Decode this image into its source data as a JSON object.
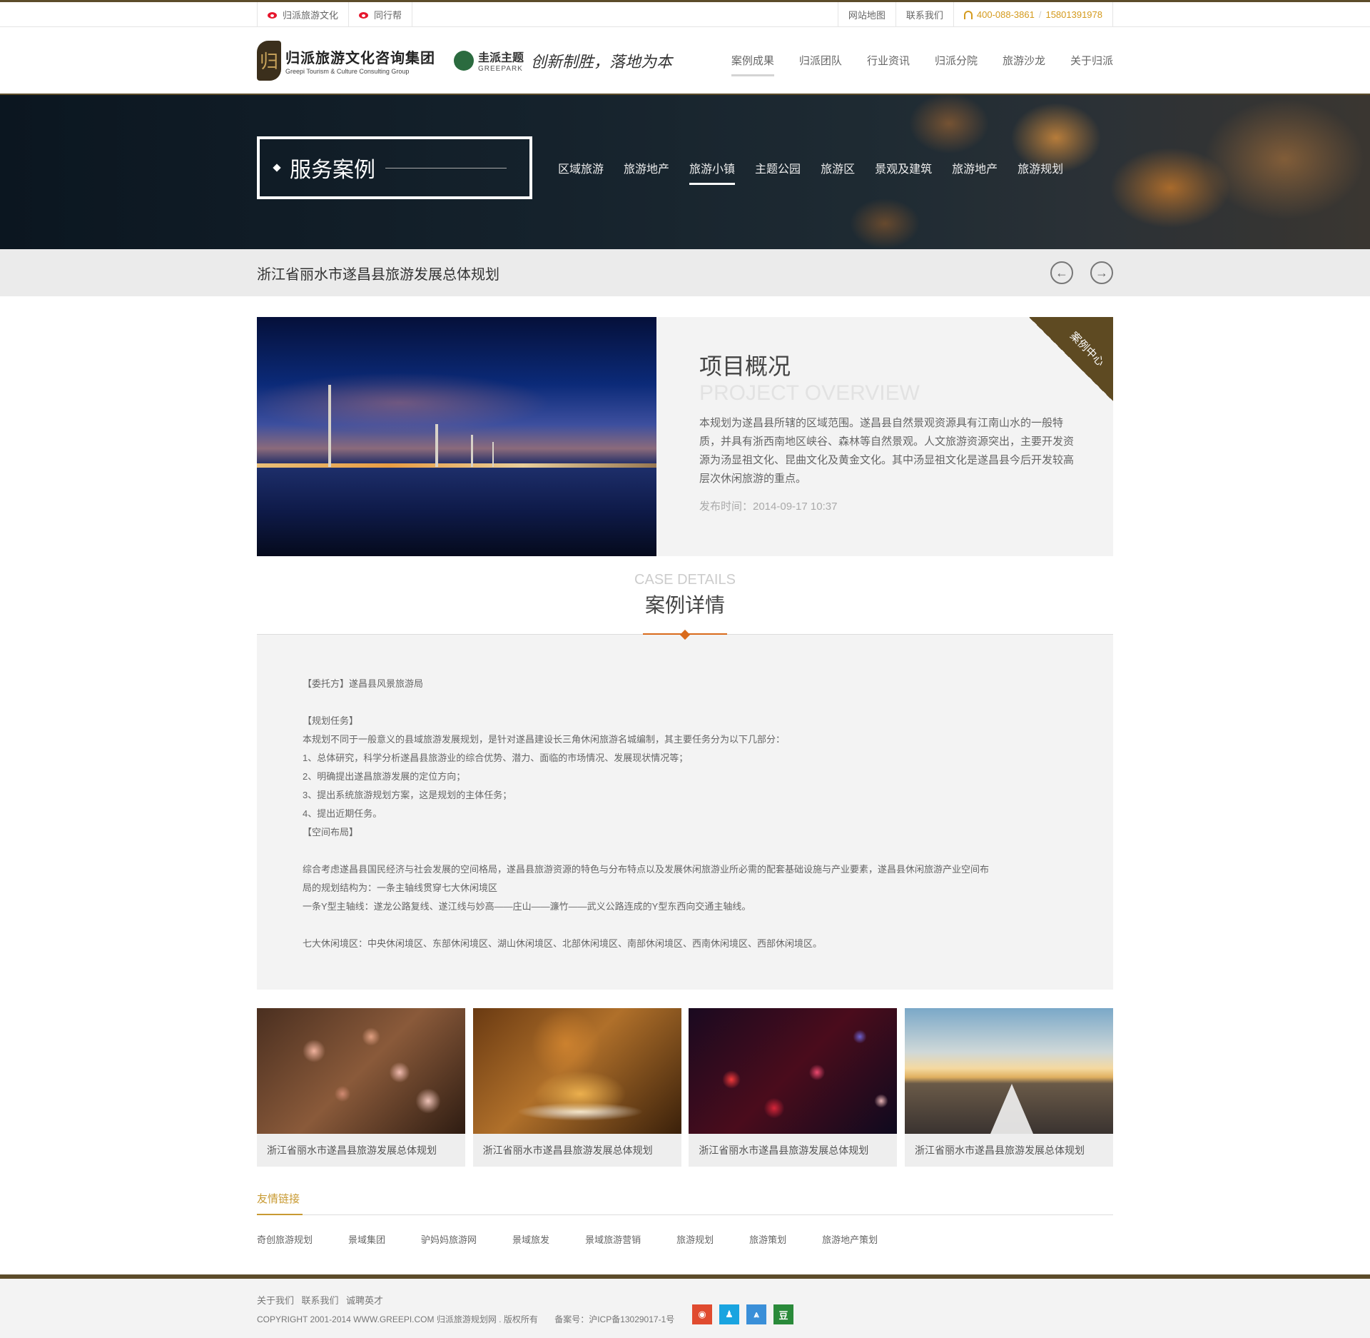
{
  "topbar": {
    "left_links": [
      "归派旅游文化",
      "同行帮"
    ],
    "right_links": [
      "网站地图",
      "联系我们"
    ],
    "phone": "400-088-3861",
    "phone_sep": "/",
    "mobile": "15801391978"
  },
  "header": {
    "logo_cn": "归派旅游文化咨询集团",
    "logo_en": "Greepi Tourism & Culture Consulting Group",
    "partner_cn": "圭派主题",
    "partner_en": "GREEPARK",
    "slogan": "创新制胜，落地为本",
    "nav": [
      "案例成果",
      "归派团队",
      "行业资讯",
      "归派分院",
      "旅游沙龙",
      "关于归派"
    ]
  },
  "banner": {
    "title": "服务案例",
    "subnav": [
      "区域旅游",
      "旅游地产",
      "旅游小镇",
      "主题公园",
      "旅游区",
      "景观及建筑",
      "旅游地产",
      "旅游规划"
    ]
  },
  "page_title": "浙江省丽水市遂昌县旅游发展总体规划",
  "overview": {
    "title": "项目概况",
    "title_en": "PROJECT OVERVIEW",
    "ribbon": "案例中心",
    "desc": "本规划为遂昌县所辖的区域范围。遂昌县自然景观资源具有江南山水的一般特质，并具有浙西南地区峡谷、森林等自然景观。人文旅游资源突出，主要开发资源为汤显祖文化、昆曲文化及黄金文化。其中汤显祖文化是遂昌县今后开发较高层次休闲旅游的重点。",
    "date": "发布时间：2014-09-17 10:37"
  },
  "details": {
    "title_en": "CASE DETAILS",
    "title": "案例详情",
    "lines": [
      "【委托方】遂昌县风景旅游局",
      "",
      "【规划任务】",
      "本规划不同于一般意义的县域旅游发展规划，是针对遂昌建设长三角休闲旅游名城编制，其主要任务分为以下几部分：",
      "1、总体研究，科学分析遂昌县旅游业的综合优势、潜力、面临的市场情况、发展现状情况等；",
      "2、明确提出遂昌旅游发展的定位方向；",
      "3、提出系统旅游规划方案，这是规划的主体任务；",
      "4、提出近期任务。",
      "【空间布局】",
      "",
      "综合考虑遂昌县国民经济与社会发展的空间格局，遂昌县旅游资源的特色与分布特点以及发展休闲旅游业所必需的配套基础设施与产业要素，遂昌县休闲旅游产业空间布",
      "局的规划结构为：一条主轴线贯穿七大休闲境区",
      "一条Y型主轴线：遂龙公路复线、遂江线与妙高——庄山——濂竹——武义公路连成的Y型东西向交通主轴线。",
      "",
      "七大休闲境区：中央休闲境区、东部休闲境区、湖山休闲境区、北部休闲境区、南部休闲境区、西南休闲境区、西部休闲境区。"
    ]
  },
  "related": [
    "浙江省丽水市遂昌县旅游发展总体规划",
    "浙江省丽水市遂昌县旅游发展总体规划",
    "浙江省丽水市遂昌县旅游发展总体规划",
    "浙江省丽水市遂昌县旅游发展总体规划"
  ],
  "friend_links": {
    "title": "友情链接",
    "items": [
      "奇创旅游规划",
      "景域集团",
      "驴妈妈旅游网",
      "景域旅发",
      "景域旅游营销",
      "旅游规划",
      "旅游策划",
      "旅游地产策划"
    ]
  },
  "footer": {
    "links": [
      "关于我们",
      "联系我们",
      "诚聘英才"
    ],
    "copyright": "COPYRIGHT 2001-2014 WWW.GREEPI.COM 归派旅游规划网 . 版权所有",
    "icp": "备案号：沪ICP备13029017-1号",
    "social": [
      {
        "icon": "weibo-icon",
        "color": "#e04b2f",
        "glyph": "◉"
      },
      {
        "icon": "qq-icon",
        "color": "#19a4e0",
        "glyph": "♟"
      },
      {
        "icon": "renren-icon",
        "color": "#3a8fd8",
        "glyph": "⩓"
      },
      {
        "icon": "douban-icon",
        "color": "#2a8a3a",
        "glyph": "豆"
      }
    ]
  }
}
